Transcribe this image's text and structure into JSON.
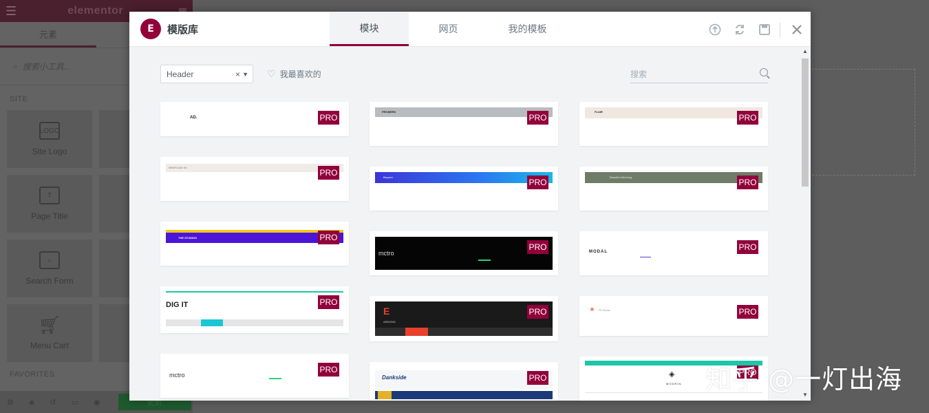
{
  "editor": {
    "logo": "elementor",
    "tab_elements": "元素",
    "search_placeholder": "搜索小工具...",
    "section_site": "SITE",
    "section_favorites": "FAVORITES",
    "widgets": [
      "Site Logo",
      "Page Title",
      "Search Form",
      "Menu Cart"
    ],
    "update_label": "更新"
  },
  "modal": {
    "title": "模版库",
    "tabs": [
      {
        "label": "模块",
        "active": true
      },
      {
        "label": "网页",
        "active": false
      },
      {
        "label": "我的模板",
        "active": false
      }
    ],
    "tools": [
      "upload-icon",
      "sync-icon",
      "save-icon",
      "close-icon"
    ],
    "filter": {
      "selected": "Header",
      "clear": "×"
    },
    "favorites_label": "我最喜欢的",
    "search_placeholder": "搜索",
    "badge_label": "PRO",
    "accent_color": "#92003b",
    "cards": [
      {
        "brand": "AD."
      },
      {
        "brand": "PROMERS"
      },
      {
        "brand": "FLAIR"
      },
      {
        "brand": "NEWS DAY IN"
      },
      {
        "brand": "Beyond"
      },
      {
        "brand": "Beautiful Meaning"
      },
      {
        "brand": "THE STUDIOS"
      },
      {
        "brand": "mctro"
      },
      {
        "brand": "MODAL"
      },
      {
        "brand": "DIG IT"
      },
      {
        "brand": "ARMOND"
      },
      {
        "brand": "Fit Studio"
      },
      {
        "brand": "mctro"
      },
      {
        "brand": "Dankside"
      },
      {
        "brand": "MODRIN"
      }
    ]
  },
  "watermark": "知乎 @一灯出海"
}
